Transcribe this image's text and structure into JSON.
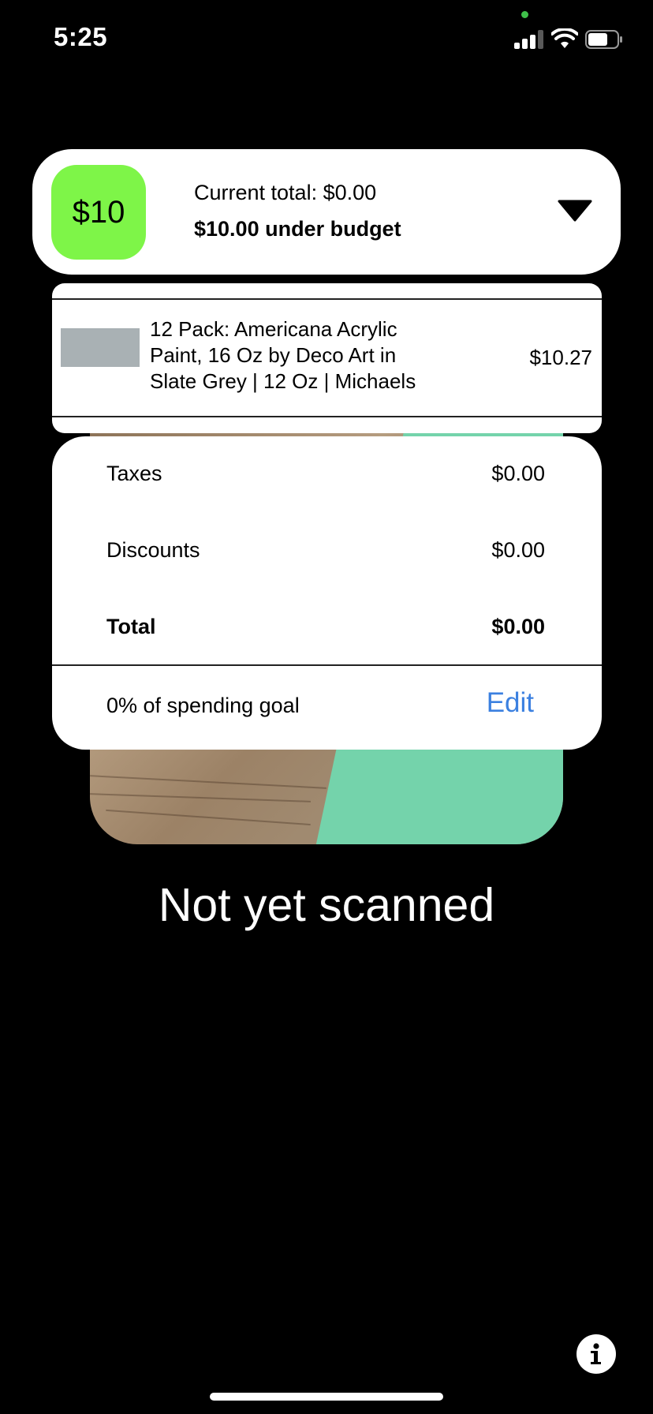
{
  "status_bar": {
    "time": "5:25",
    "icons": [
      "camera-in-use-dot",
      "cellular-signal-icon",
      "wifi-icon",
      "battery-icon"
    ]
  },
  "budget": {
    "badge": "$10",
    "current_total": "Current total: $0.00",
    "status": "$10.00 under budget",
    "badge_color": "#7ef548",
    "toggle_icon": "chevron-down-triangle"
  },
  "item": {
    "name": "12 Pack: Americana Acrylic Paint, 16 Oz by Deco Art in Slate Grey | 12 Oz | Michaels",
    "price": "$10.27"
  },
  "totals": {
    "taxes_label": "Taxes",
    "taxes_value": "$0.00",
    "discounts_label": "Discounts",
    "discounts_value": "$0.00",
    "total_label": "Total",
    "total_value": "$0.00",
    "goal_text": "0% of spending goal",
    "edit_label": "Edit",
    "edit_color": "#3b80e0"
  },
  "scan_status": "Not yet scanned",
  "info_icon": "info-icon"
}
